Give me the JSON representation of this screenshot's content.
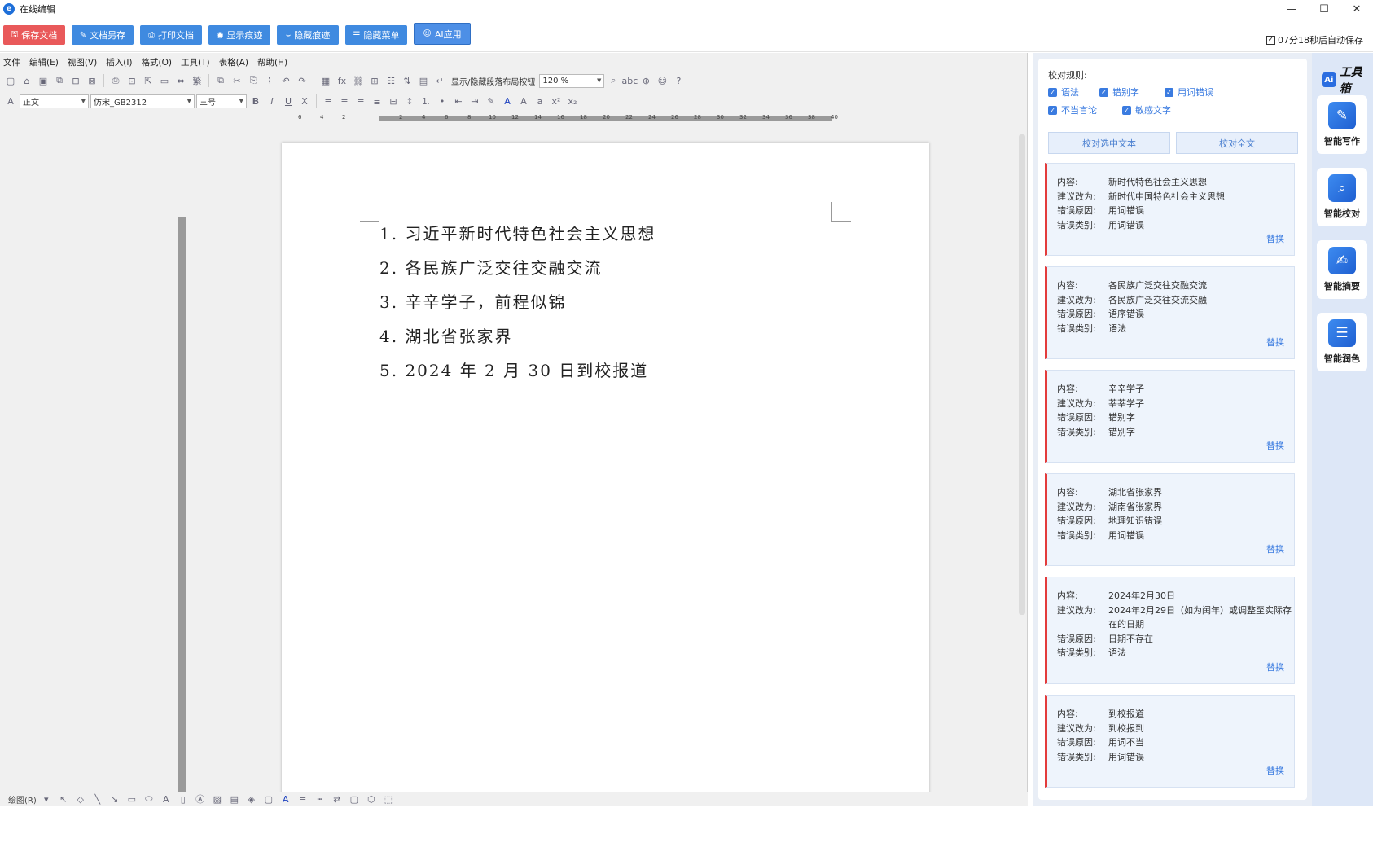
{
  "window": {
    "title": "在线编辑",
    "controls": [
      "—",
      "☐",
      "✕"
    ]
  },
  "topbar": {
    "buttons": [
      {
        "label": "保存文档",
        "icon": "save-icon",
        "color": "#e9595a"
      },
      {
        "label": "文档另存",
        "icon": "save-as-icon",
        "color": "#3f8ae0"
      },
      {
        "label": "打印文档",
        "icon": "print-icon",
        "color": "#3f8ae0"
      },
      {
        "label": "显示痕迹",
        "icon": "eye-icon",
        "color": "#3f8ae0"
      },
      {
        "label": "隐藏痕迹",
        "icon": "eye-closed-icon",
        "color": "#3f8ae0"
      },
      {
        "label": "隐藏菜单",
        "icon": "menu-icon",
        "color": "#3f8ae0"
      }
    ],
    "ai_button": "AI应用",
    "autosave": "07分18秒后自动保存",
    "autosave_checked": true
  },
  "menubar": [
    "文件",
    "编辑(E)",
    "视图(V)",
    "插入(I)",
    "格式(O)",
    "工具(T)",
    "表格(A)",
    "帮助(H)"
  ],
  "toolbar": {
    "toggle_label": "显示/隐藏段落布局按钮",
    "zoom": "120 %",
    "style": "正文",
    "font": "仿宋_GB2312",
    "size": "三号"
  },
  "ruler_ticks": [
    "6",
    "4",
    "2",
    "",
    "2",
    "4",
    "6",
    "8",
    "10",
    "12",
    "14",
    "16",
    "18",
    "20",
    "22",
    "24",
    "26",
    "28",
    "30",
    "32",
    "34",
    "36",
    "38",
    "40",
    "42",
    "44",
    "46"
  ],
  "document": {
    "items": [
      "1. 习近平新时代特色社会主义思想",
      "2. 各民族广泛交往交融交流",
      "3. 辛辛学子，前程似锦",
      "4. 湖北省张家界",
      "5. 2024 年 2 月 30 日到校报道"
    ]
  },
  "drawbar": {
    "label": "绘图(R)"
  },
  "check_panel": {
    "rules_title": "校对规则:",
    "rules": [
      {
        "label": "语法",
        "checked": true
      },
      {
        "label": "错别字",
        "checked": true
      },
      {
        "label": "用词错误",
        "checked": true
      },
      {
        "label": "不当言论",
        "checked": true
      },
      {
        "label": "敏感文字",
        "checked": true
      }
    ],
    "check_selected": "校对选中文本",
    "check_all": "校对全文",
    "labels": {
      "content": "内容:",
      "suggest": "建议改为:",
      "reason": "错误原因:",
      "category": "错误类别:",
      "replace": "替换"
    },
    "results": [
      {
        "content": "新时代特色社会主义思想",
        "suggest": "新时代中国特色社会主义思想",
        "reason": "用词错误",
        "category": "用词错误"
      },
      {
        "content": "各民族广泛交往交融交流",
        "suggest": "各民族广泛交往交流交融",
        "reason": "语序错误",
        "category": "语法"
      },
      {
        "content": "辛辛学子",
        "suggest": "莘莘学子",
        "reason": "错别字",
        "category": "错别字"
      },
      {
        "content": "湖北省张家界",
        "suggest": "湖南省张家界",
        "reason": "地理知识错误",
        "category": "用词错误"
      },
      {
        "content": "2024年2月30日",
        "suggest": "2024年2月29日（如为闰年）或调整至实际存在的日期",
        "reason": "日期不存在",
        "category": "语法"
      },
      {
        "content": "到校报道",
        "suggest": "到校报到",
        "reason": "用词不当",
        "category": "用词错误"
      }
    ]
  },
  "toolbox": {
    "title": "工具箱",
    "ai_badge": "Ai",
    "tools": [
      {
        "label": "智能写作",
        "icon": "pen-icon"
      },
      {
        "label": "智能校对",
        "icon": "proofread-icon"
      },
      {
        "label": "智能摘要",
        "icon": "summary-icon"
      },
      {
        "label": "智能润色",
        "icon": "polish-icon"
      }
    ]
  },
  "colors": {
    "accent": "#3a7be0",
    "danger": "#e33b3b",
    "button_blue": "#3f8ae0",
    "button_red": "#e9595a"
  }
}
